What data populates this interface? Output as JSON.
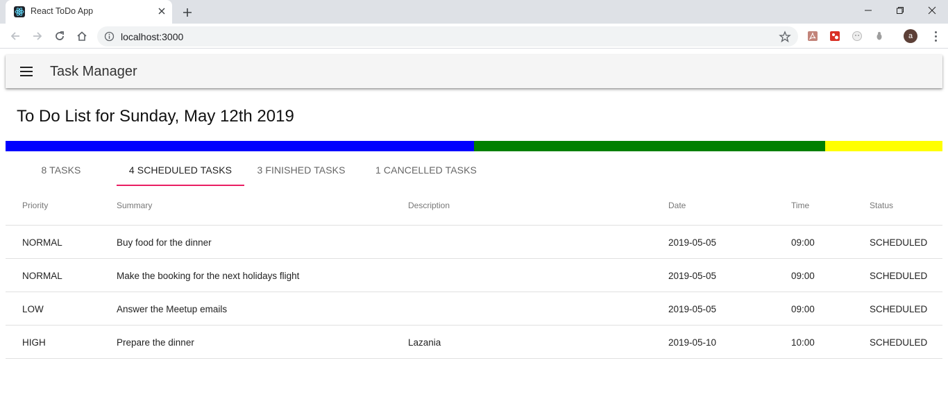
{
  "browser": {
    "tab_title": "React ToDo App",
    "url": "localhost:3000"
  },
  "app": {
    "title": "Task Manager",
    "page_title": "To Do List for Sunday, May 12th 2019"
  },
  "progress": {
    "segments": [
      {
        "name": "scheduled",
        "fraction": 0.5,
        "color": "#0000ff"
      },
      {
        "name": "finished",
        "fraction": 0.375,
        "color": "#008000"
      },
      {
        "name": "cancelled",
        "fraction": 0.125,
        "color": "#ffff00"
      }
    ]
  },
  "tabs": [
    {
      "label": "8 TASKS"
    },
    {
      "label": "4 SCHEDULED TASKS",
      "selected": true
    },
    {
      "label": "3 FINISHED TASKS"
    },
    {
      "label": "1 CANCELLED TASKS"
    }
  ],
  "accent_color": "#e91e63",
  "table": {
    "columns": [
      "Priority",
      "Summary",
      "Description",
      "Date",
      "Time",
      "Status"
    ],
    "rows": [
      [
        "NORMAL",
        "Buy food for the dinner",
        "",
        "2019-05-05",
        "09:00",
        "SCHEDULED"
      ],
      [
        "NORMAL",
        "Make the booking for the next holidays flight",
        "",
        "2019-05-05",
        "09:00",
        "SCHEDULED"
      ],
      [
        "LOW",
        "Answer the Meetup emails",
        "",
        "2019-05-05",
        "09:00",
        "SCHEDULED"
      ],
      [
        "HIGH",
        "Prepare the dinner",
        "Lazania",
        "2019-05-10",
        "10:00",
        "SCHEDULED"
      ]
    ]
  }
}
